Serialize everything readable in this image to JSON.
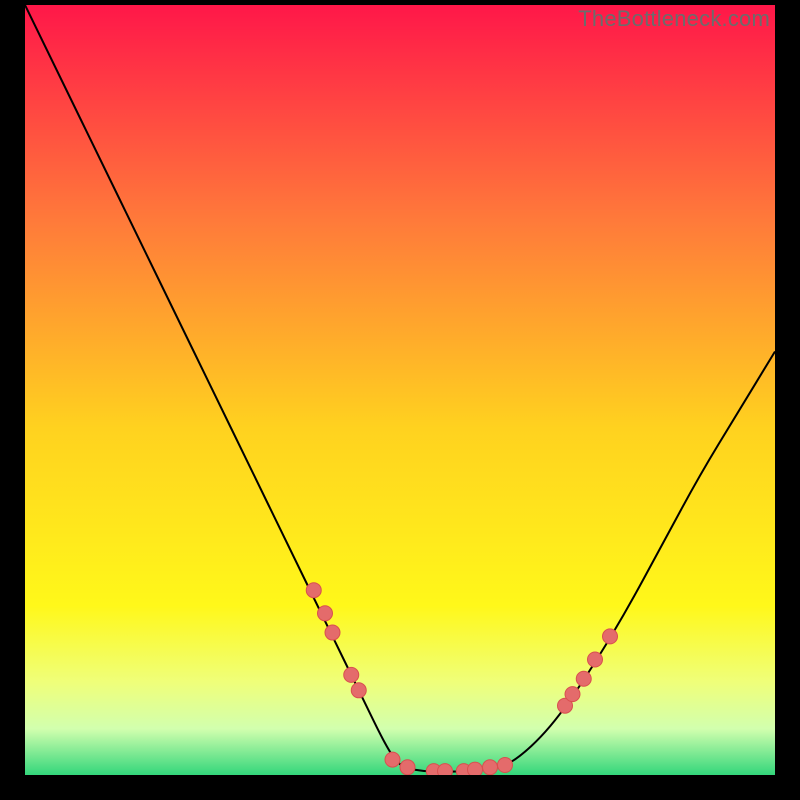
{
  "watermark": "TheBottleneck.com",
  "colors": {
    "gradient_top": "#ff1749",
    "gradient_mid_upper": "#ff7a3a",
    "gradient_mid": "#ffd21f",
    "gradient_mid_lower": "#fff81a",
    "gradient_low1": "#efff7a",
    "gradient_low2": "#d2ffae",
    "gradient_bottom": "#33d67b",
    "curve": "#000000",
    "marker_fill": "#e46b6b",
    "marker_stroke": "#d94f4f",
    "frame": "#000000"
  },
  "chart_data": {
    "type": "line",
    "title": "",
    "xlabel": "",
    "ylabel": "",
    "xlim": [
      0,
      100
    ],
    "ylim": [
      0,
      100
    ],
    "curve": {
      "left_branch": {
        "x": [
          0,
          5,
          10,
          15,
          20,
          25,
          30,
          35,
          40,
          45,
          48,
          50
        ],
        "y": [
          100,
          90,
          80,
          70,
          60,
          50,
          40,
          30,
          20,
          10,
          4,
          1
        ]
      },
      "valley": {
        "x": [
          50,
          53,
          56,
          59,
          62,
          65
        ],
        "y": [
          1,
          0.5,
          0.4,
          0.5,
          0.8,
          1.5
        ]
      },
      "right_branch": {
        "x": [
          65,
          70,
          75,
          80,
          85,
          90,
          95,
          100
        ],
        "y": [
          1.5,
          6,
          13,
          21,
          30,
          39,
          47,
          55
        ]
      }
    },
    "markers": [
      {
        "x": 38.5,
        "y": 24.0
      },
      {
        "x": 40.0,
        "y": 21.0
      },
      {
        "x": 41.0,
        "y": 18.5
      },
      {
        "x": 43.5,
        "y": 13.0
      },
      {
        "x": 44.5,
        "y": 11.0
      },
      {
        "x": 49.0,
        "y": 2.0
      },
      {
        "x": 51.0,
        "y": 1.0
      },
      {
        "x": 54.5,
        "y": 0.5
      },
      {
        "x": 56.0,
        "y": 0.5
      },
      {
        "x": 58.5,
        "y": 0.5
      },
      {
        "x": 60.0,
        "y": 0.7
      },
      {
        "x": 62.0,
        "y": 1.0
      },
      {
        "x": 64.0,
        "y": 1.3
      },
      {
        "x": 72.0,
        "y": 9.0
      },
      {
        "x": 73.0,
        "y": 10.5
      },
      {
        "x": 74.5,
        "y": 12.5
      },
      {
        "x": 76.0,
        "y": 15.0
      },
      {
        "x": 78.0,
        "y": 18.0
      }
    ]
  }
}
